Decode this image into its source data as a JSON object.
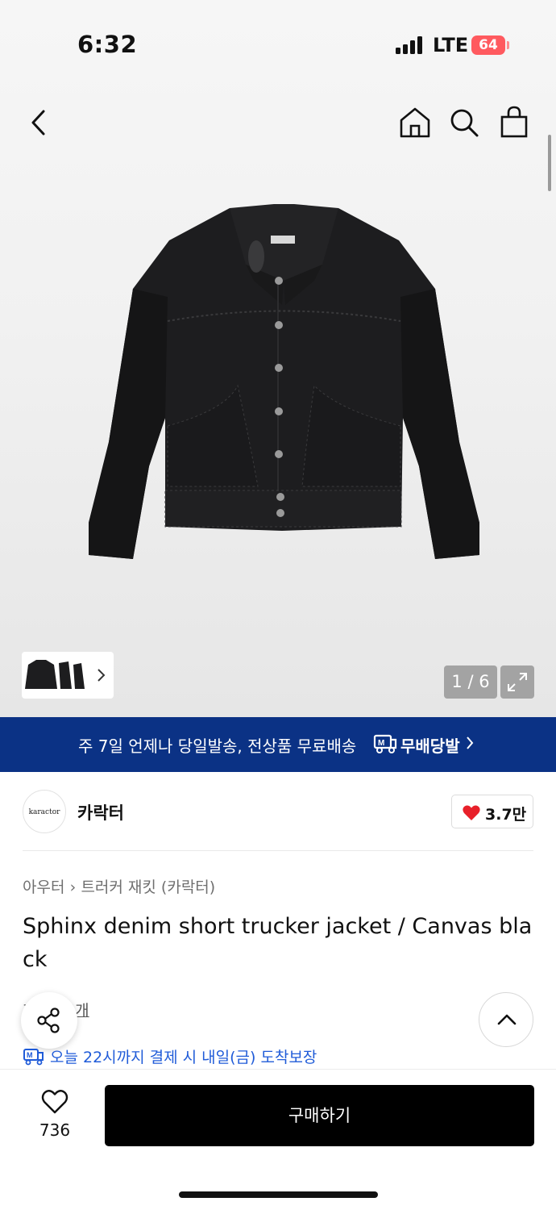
{
  "status_bar": {
    "time": "6:32",
    "network": "LTE",
    "battery": "64"
  },
  "nav": {
    "back_icon": "chevron-left-icon",
    "home_icon": "home-icon",
    "search_icon": "search-icon",
    "bag_icon": "shopping-bag-icon"
  },
  "gallery": {
    "counter": "1 / 6",
    "expand_icon": "expand-icon"
  },
  "banner": {
    "text": "주 7일 언제나 당일발송, 전상품 무료배송",
    "brand": "무배당발",
    "chevron": "›"
  },
  "brand": {
    "logo_text": "karactor",
    "name": "카락터",
    "likes": "3.7만"
  },
  "breadcrumb": {
    "category": "아우터",
    "sub": "트러커 재킷 (카락터)"
  },
  "product": {
    "title": "Sphinx denim short trucker jacket / Canvas black",
    "reviews": "후기 14개",
    "arrival": "오늘 22시까지 결제 시 내일(금) 도착보장"
  },
  "bottom_bar": {
    "wish_count": "736",
    "buy_label": "구매하기"
  },
  "colors": {
    "banner_bg": "#0b3285",
    "accent_blue": "#1f5bd8",
    "heart_red": "#e8202a",
    "buy_bg": "#000000"
  }
}
